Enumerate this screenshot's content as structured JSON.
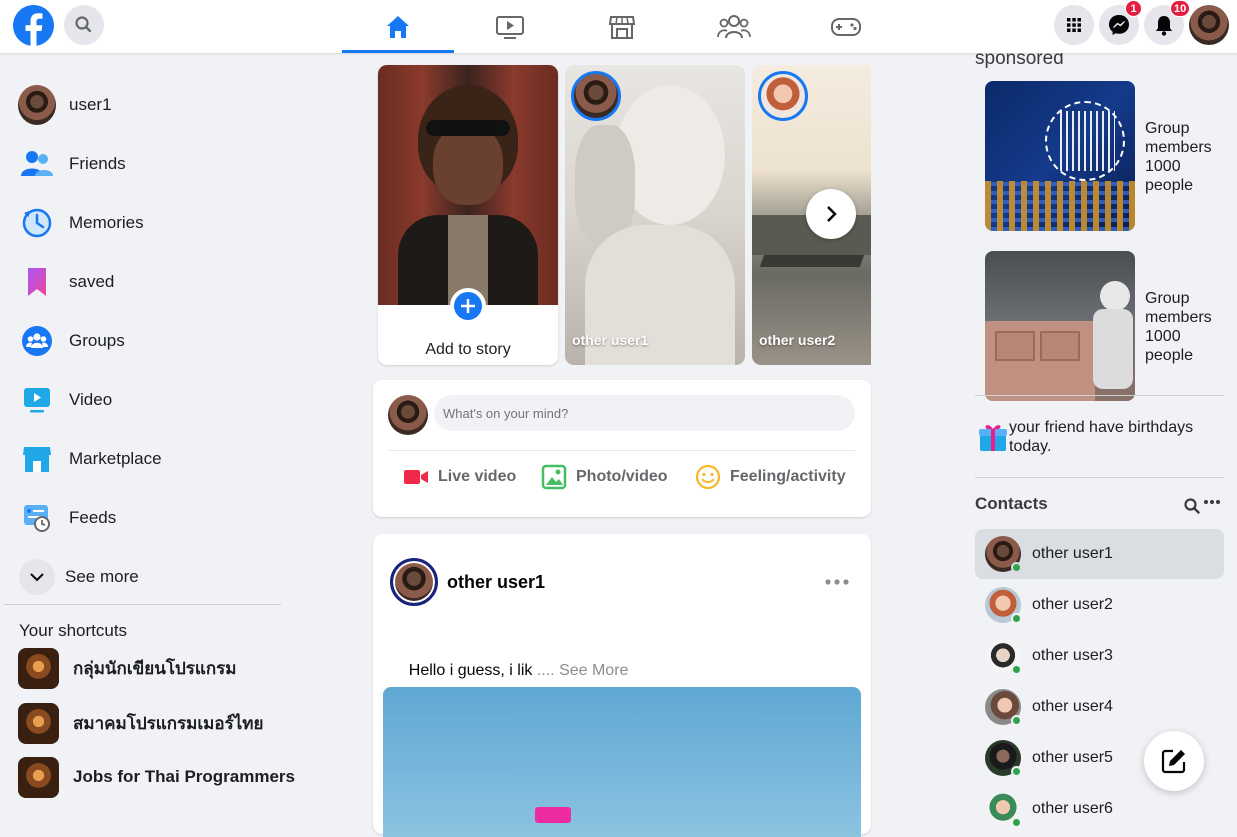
{
  "header": {
    "logo": "facebook-logo",
    "nav_tabs": [
      "home",
      "watch",
      "marketplace",
      "groups",
      "gaming"
    ],
    "messenger_badge": "1",
    "notifications_badge": "10"
  },
  "left_nav": {
    "user_name": "user1",
    "items": [
      {
        "label": "Friends",
        "icon": "friends-icon"
      },
      {
        "label": "Memories",
        "icon": "memories-icon"
      },
      {
        "label": "saved",
        "icon": "saved-icon"
      },
      {
        "label": "Groups",
        "icon": "groups-icon"
      },
      {
        "label": "Video",
        "icon": "video-icon"
      },
      {
        "label": "Marketplace",
        "icon": "marketplace-icon"
      },
      {
        "label": "Feeds",
        "icon": "feeds-icon"
      }
    ],
    "see_more": "See more",
    "shortcuts_title": "Your shortcuts",
    "shortcuts": [
      "กลุ่มนักเขียนโปรแกรม",
      "สมาคมโปรแกรมเมอร์ไทย",
      "Jobs for Thai Programmers"
    ]
  },
  "stories": {
    "add_label": "Add to story",
    "items": [
      {
        "name": "other user1"
      },
      {
        "name": "other user2"
      }
    ]
  },
  "composer": {
    "placeholder": "What's on your mind?",
    "live": "Live video",
    "photo": "Photo/video",
    "feeling": "Feeling/activity"
  },
  "post": {
    "author": "other user1",
    "text": "Hello i guess, i lik",
    "ellipsis": " .... ",
    "see_more": "See More"
  },
  "right": {
    "sponsored_title": "sponsored",
    "ads": [
      {
        "text": "Group members 1000 people"
      },
      {
        "text": "Group members 1000 people"
      }
    ],
    "birthday": "your friend have birthdays today.",
    "contacts_title": "Contacts",
    "contacts": [
      "other user1",
      "other user2",
      "other user3",
      "other user4",
      "other user5",
      "other user6"
    ]
  },
  "colors": {
    "brand": "#1877f2",
    "online": "#31a24c",
    "badge": "#e41e3f"
  }
}
